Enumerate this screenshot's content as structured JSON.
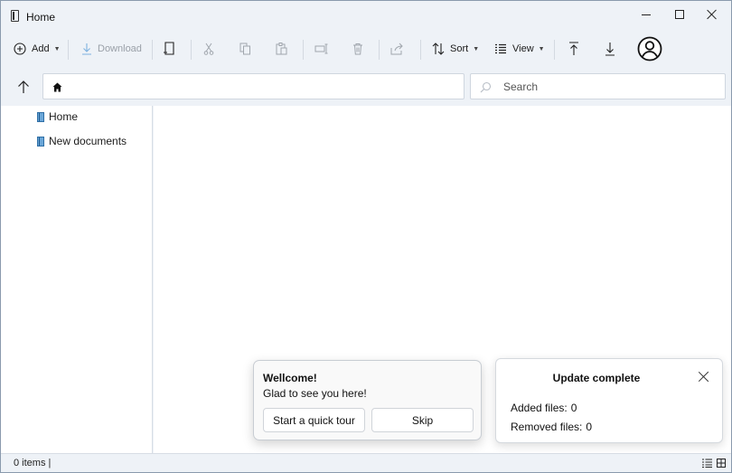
{
  "window": {
    "title": "Home"
  },
  "toolbar": {
    "add_label": "Add",
    "download_label": "Download",
    "sort_label": "Sort",
    "view_label": "View",
    "icons": [
      "plus-circle-icon",
      "download-icon",
      "new-folder-icon",
      "cut-icon",
      "copy-icon",
      "paste-icon",
      "rename-icon",
      "delete-icon",
      "share-icon",
      "sort-icon",
      "list-view-icon",
      "upload-icon",
      "download-arrow-icon",
      "user-avatar-icon"
    ]
  },
  "address_bar": {
    "value": ""
  },
  "search": {
    "placeholder": "Search",
    "value": ""
  },
  "nav_tree": {
    "items": [
      {
        "label": "Home",
        "icon": "document-icon"
      },
      {
        "label": "New documents",
        "icon": "document-icon"
      }
    ]
  },
  "statusbar": {
    "items_text": "0 items |"
  },
  "welcome_popup": {
    "title": "Wellcome!",
    "message": "Glad to see you here!",
    "tour_button": "Start a quick tour",
    "skip_button": "Skip"
  },
  "update_popup": {
    "title": "Update complete",
    "added_label": "Added files:",
    "added_value": "0",
    "removed_label": "Removed files:",
    "removed_value": "0"
  },
  "colors": {
    "chrome": "#eef2f7",
    "disabled_text": "#9aa0a8",
    "doc_icon": "#6aa6d8",
    "border": "#cfd6df"
  }
}
